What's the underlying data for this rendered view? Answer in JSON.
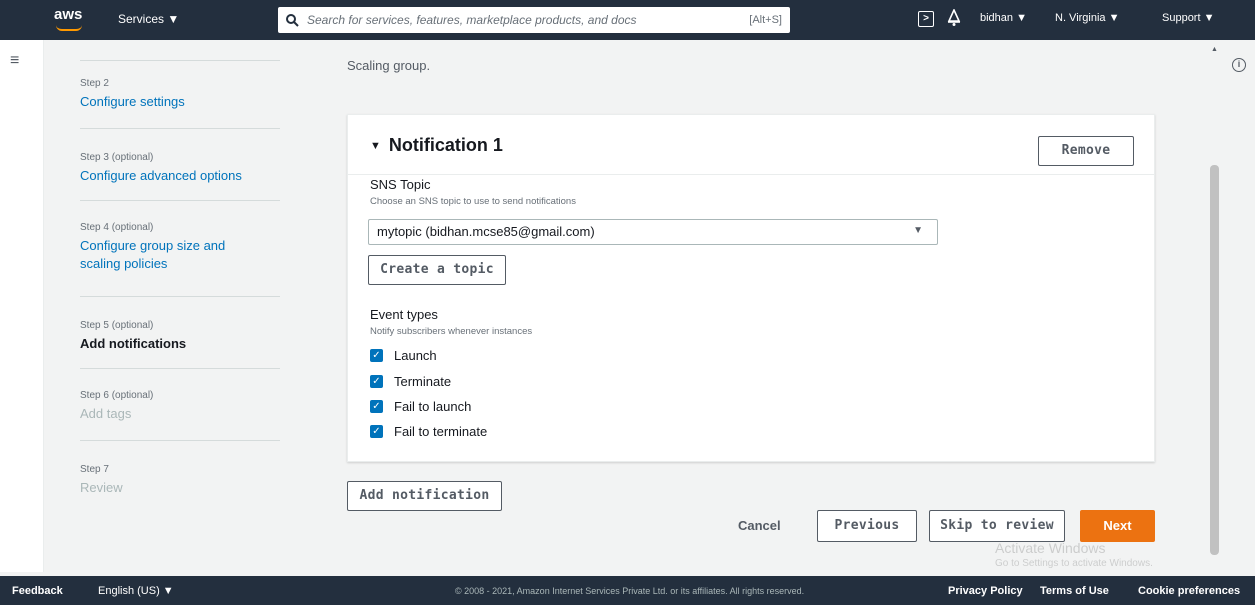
{
  "topnav": {
    "logo_text": "aws",
    "services_label": "Services ▼",
    "search_placeholder": "Search for services, features, marketplace products, and docs",
    "search_shortcut": "[Alt+S]",
    "user_label": "bidhan ▼",
    "region_label": "N. Virginia ▼",
    "support_label": "Support ▼"
  },
  "steps": [
    {
      "label": "Step 2",
      "title": "Configure settings",
      "state": "link"
    },
    {
      "label": "Step 3 (optional)",
      "title": "Configure advanced options",
      "state": "link"
    },
    {
      "label": "Step 4 (optional)",
      "title": "Configure group size and scaling policies",
      "state": "link"
    },
    {
      "label": "Step 5 (optional)",
      "title": "Add notifications",
      "state": "active"
    },
    {
      "label": "Step 6 (optional)",
      "title": "Add tags",
      "state": "disabled"
    },
    {
      "label": "Step 7",
      "title": "Review",
      "state": "disabled"
    }
  ],
  "intro_text": "Scaling group.",
  "notification": {
    "title": "Notification 1",
    "remove_label": "Remove",
    "sns_label": "SNS Topic",
    "sns_desc": "Choose an SNS topic to use to send notifications",
    "sns_value": "mytopic (bidhan.mcse85@gmail.com)",
    "create_topic_label": "Create a topic",
    "event_label": "Event types",
    "event_desc": "Notify subscribers whenever instances",
    "events": [
      {
        "label": "Launch",
        "checked": true
      },
      {
        "label": "Terminate",
        "checked": true
      },
      {
        "label": "Fail to launch",
        "checked": true
      },
      {
        "label": "Fail to terminate",
        "checked": true
      }
    ]
  },
  "actions": {
    "add_notification_label": "Add notification",
    "cancel_label": "Cancel",
    "previous_label": "Previous",
    "skip_label": "Skip to review",
    "next_label": "Next"
  },
  "watermark": {
    "line1": "Activate Windows",
    "line2": "Go to Settings to activate Windows."
  },
  "footer": {
    "feedback": "Feedback",
    "language": "English (US) ▼",
    "copyright": "© 2008 - 2021, Amazon Internet Services Private Ltd. or its affiliates. All rights reserved.",
    "privacy": "Privacy Policy",
    "terms": "Terms of Use",
    "cookies": "Cookie preferences"
  },
  "colors": {
    "nav_bg": "#232f3e",
    "accent": "#ec7211",
    "link": "#0073bb",
    "checkbox": "#0073bb"
  }
}
